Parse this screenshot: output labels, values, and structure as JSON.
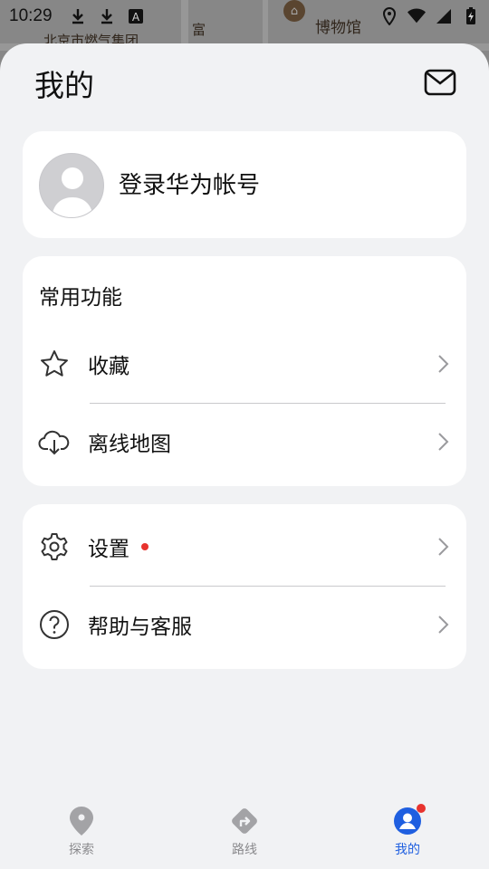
{
  "status_bar": {
    "time": "10:29"
  },
  "map": {
    "labels": [
      "北京市燃气集团",
      "富",
      "博物馆"
    ]
  },
  "sheet": {
    "title": "我的",
    "mail_icon": "mail-icon"
  },
  "profile": {
    "login_label": "登录华为帐号"
  },
  "features": {
    "section_title": "常用功能",
    "items": [
      {
        "label": "收藏",
        "icon": "star-icon"
      },
      {
        "label": "离线地图",
        "icon": "cloud-download-icon"
      }
    ]
  },
  "settings": {
    "items": [
      {
        "label": "设置",
        "icon": "gear-icon",
        "badge": true
      },
      {
        "label": "帮助与客服",
        "icon": "help-icon"
      }
    ]
  },
  "bottom_nav": {
    "items": [
      {
        "label": "探索",
        "icon": "location-pin-icon",
        "active": false
      },
      {
        "label": "路线",
        "icon": "route-icon",
        "active": false
      },
      {
        "label": "我的",
        "icon": "profile-icon",
        "active": true,
        "badge": true
      }
    ]
  },
  "colors": {
    "accent": "#1f5fe0",
    "badge": "#e8332e",
    "sheet_bg": "#f1f2f4"
  }
}
